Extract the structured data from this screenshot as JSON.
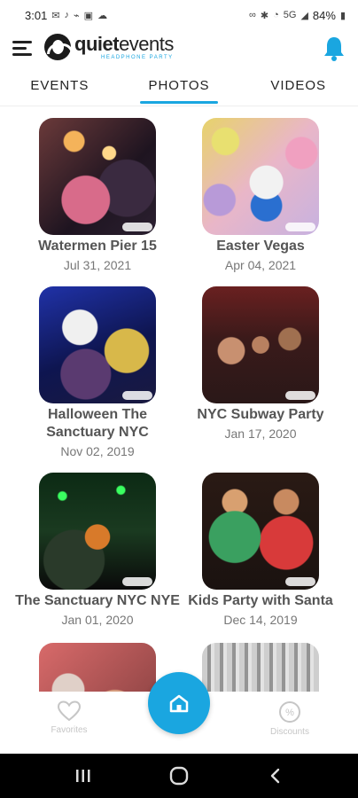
{
  "status_bar": {
    "time": "3:01",
    "network": "5G",
    "battery": "84%"
  },
  "app": {
    "logo_name_bold": "quiet",
    "logo_name_light": "events",
    "logo_tagline": "HEADPHONE PARTY",
    "accent_color": "#1aa6e0"
  },
  "tabs": [
    {
      "label": "EVENTS",
      "active": false
    },
    {
      "label": "PHOTOS",
      "active": true
    },
    {
      "label": "VIDEOS",
      "active": false
    }
  ],
  "albums": [
    {
      "title": "Watermen Pier 15",
      "date": "Jul 31, 2021"
    },
    {
      "title": "Easter Vegas",
      "date": "Apr 04, 2021"
    },
    {
      "title": "Halloween The Sanctuary NYC",
      "date": "Nov 02, 2019"
    },
    {
      "title": "NYC Subway Party",
      "date": "Jan 17, 2020"
    },
    {
      "title": "The Sanctuary NYC NYE",
      "date": "Jan 01, 2020"
    },
    {
      "title": "Kids Party with Santa",
      "date": "Dec 14, 2019"
    },
    {
      "title": "",
      "date": ""
    },
    {
      "title": "",
      "date": ""
    }
  ],
  "bottom_nav": {
    "favorites_label": "Favorites",
    "discounts_label": "Discounts",
    "home_icon": "home-icon"
  }
}
